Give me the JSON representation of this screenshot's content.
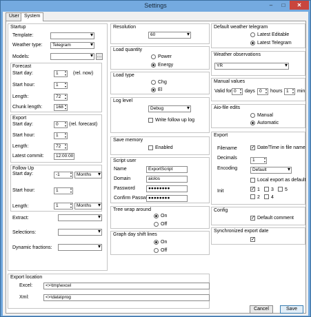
{
  "window": {
    "title": "Settings",
    "min": "–",
    "max": "□",
    "close": "✕"
  },
  "tabs": [
    "User",
    "System"
  ],
  "startup": {
    "title": "Startup",
    "template_label": "Template:",
    "template_value": "",
    "weather_type_label": "Weather type:",
    "weather_type_value": "Telegram",
    "models_label": "Models:",
    "models_value": ""
  },
  "forecast": {
    "title": "Forecast",
    "start_day_label": "Start day:",
    "start_day_value": "1",
    "start_day_note": "(rel. now)",
    "start_hour_label": "Start hour:",
    "start_hour_value": "1",
    "length_label": "Length:",
    "length_value": "72",
    "chunk_length_label": "Chunk length:",
    "chunk_length_value": "168"
  },
  "export_left": {
    "title": "Export",
    "start_day_label": "Start day:",
    "start_day_value": "0",
    "start_day_note": "(rel. forecast)",
    "start_hour_label": "Start hour:",
    "start_hour_value": "1",
    "length_label": "Length:",
    "length_value": "72",
    "latest_commit_label": "Latest commit:",
    "latest_commit_value": "12:00:00"
  },
  "follow_up": {
    "title": "Follow Up",
    "start_day_label": "Start day:",
    "start_day_value": "-1",
    "start_day_unit": "Months",
    "start_hour_label": "Start hour:",
    "start_hour_value": "1",
    "length_label": "Length:",
    "length_value": "1",
    "length_unit": "Months"
  },
  "extract": {
    "label": "Extract:",
    "value": ""
  },
  "selections": {
    "label": "Selections:",
    "value": ""
  },
  "dynamic": {
    "label": "Dynamic fractions:",
    "value": ""
  },
  "export_location": {
    "title": "Export location",
    "excel_label": "Excel:",
    "excel_value": "<>\\tmp\\excel",
    "xml_label": "Xml:",
    "xml_value": "<>\\data\\prog"
  },
  "resolution": {
    "title": "Resolution",
    "value": "60"
  },
  "load_quantity": {
    "title": "Load quantity",
    "options": [
      "Power",
      "Energy"
    ]
  },
  "load_type": {
    "title": "Load type",
    "options": [
      "Chg",
      "El"
    ]
  },
  "log_level": {
    "title": "Log level",
    "value": "Debug",
    "follow_up_log": "Write follow up log"
  },
  "save_memory": {
    "title": "Save memory",
    "enabled": "Enabled"
  },
  "script_user": {
    "title": "Script user",
    "name_label": "Name",
    "name_value": "ExportScript",
    "domain_label": "Domain",
    "domain_value": "aiolos",
    "password_label": "Password",
    "password_value": "●●●●●●●●",
    "confirm_label": "Confirm Password",
    "confirm_value": "●●●●●●●●"
  },
  "tree_wrap": {
    "title": "Tree wrap around",
    "options": [
      "On",
      "Off"
    ]
  },
  "graph_shift": {
    "title": "Graph day shift lines",
    "options": [
      "On",
      "Off"
    ]
  },
  "default_telegram": {
    "title": "Default weather telegram",
    "options": [
      "Latest Editable",
      "Latest Telegram"
    ]
  },
  "weather_obs": {
    "title": "Weather observations",
    "value": "YR"
  },
  "manual_values": {
    "title": "Manual values",
    "valid_for": "Valid for",
    "days_value": "0",
    "days": "days",
    "hours_value": "0",
    "hours": "hours",
    "min_value": "1",
    "min": "min"
  },
  "aio_edits": {
    "title": "Aio-file edits",
    "options": [
      "Manual",
      "Automatic"
    ]
  },
  "export_right": {
    "title": "Export",
    "filename_label": "Filename",
    "filename_check": "Date/Time in file name",
    "decimals_label": "Decimals",
    "decimals_value": "1",
    "encoding_label": "Encoding",
    "encoding_value": "Default",
    "local_export": "Local export as default",
    "init_label": "Init",
    "init_nums": [
      "1",
      "2",
      "3",
      "4",
      "5"
    ]
  },
  "config": {
    "title": "Config",
    "default_comment": "Default comment"
  },
  "sync_export": {
    "title": "Synchronized export date"
  },
  "buttons": {
    "cancel": "Cancel",
    "save": "Save"
  },
  "check_mark": "✓"
}
